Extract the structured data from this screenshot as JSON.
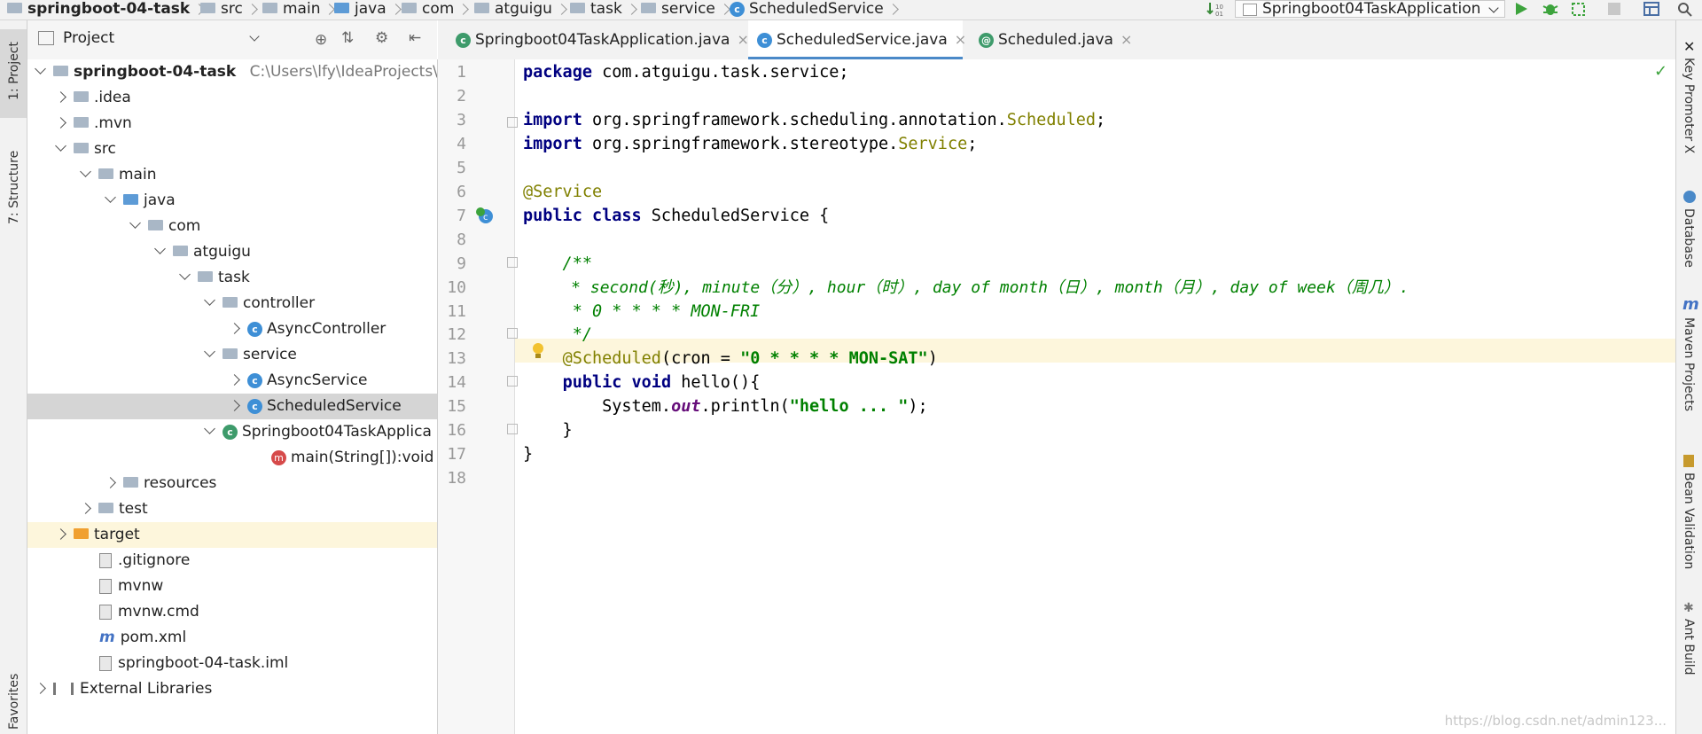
{
  "breadcrumbs": [
    "springboot-04-task",
    "src",
    "main",
    "java",
    "com",
    "atguigu",
    "task",
    "service",
    "ScheduledService"
  ],
  "run_config": "Springboot04TaskApplication",
  "left_stripe": {
    "project": "1: Project",
    "structure": "7: Structure",
    "favorites": "Favorites"
  },
  "right_stripe": {
    "key_promoter": "Key Promoter X",
    "database": "Database",
    "maven": "Maven Projects",
    "bean": "Bean Validation",
    "ant": "Ant Build"
  },
  "project_panel": {
    "title": "Project",
    "root_path": "C:\\Users\\lfy\\IdeaProjects\\sp",
    "tree": [
      {
        "label": "springboot-04-task",
        "icon": "module-folder-icon",
        "level": 0,
        "state": "open"
      },
      {
        "label": ".idea",
        "icon": "folder-icon",
        "level": 1,
        "state": "closed"
      },
      {
        "label": ".mvn",
        "icon": "folder-icon",
        "level": 1,
        "state": "closed"
      },
      {
        "label": "src",
        "icon": "folder-icon",
        "level": 1,
        "state": "open"
      },
      {
        "label": "main",
        "icon": "folder-icon",
        "level": 2,
        "state": "open"
      },
      {
        "label": "java",
        "icon": "source-folder-icon",
        "level": 3,
        "state": "open"
      },
      {
        "label": "com",
        "icon": "package-icon",
        "level": 4,
        "state": "open"
      },
      {
        "label": "atguigu",
        "icon": "package-icon",
        "level": 5,
        "state": "open"
      },
      {
        "label": "task",
        "icon": "package-icon",
        "level": 6,
        "state": "open"
      },
      {
        "label": "controller",
        "icon": "package-icon",
        "level": 7,
        "state": "open"
      },
      {
        "label": "AsyncController",
        "icon": "class-icon",
        "level": 8,
        "state": "closed"
      },
      {
        "label": "service",
        "icon": "package-icon",
        "level": 7,
        "state": "open"
      },
      {
        "label": "AsyncService",
        "icon": "class-icon",
        "level": 8,
        "state": "closed"
      },
      {
        "label": "ScheduledService",
        "icon": "class-icon",
        "level": 8,
        "state": "closed",
        "selected": true
      },
      {
        "label": "Springboot04TaskApplica",
        "icon": "spring-class-icon",
        "level": 7,
        "state": "open"
      },
      {
        "label": "main(String[]):void",
        "icon": "method-icon",
        "level": 8,
        "state": "none"
      },
      {
        "label": "resources",
        "icon": "resources-folder-icon",
        "level": 3,
        "state": "closed"
      },
      {
        "label": "test",
        "icon": "folder-icon",
        "level": 2,
        "state": "closed"
      },
      {
        "label": "target",
        "icon": "excluded-folder-icon",
        "level": 1,
        "state": "closed",
        "highlight": true
      },
      {
        "label": ".gitignore",
        "icon": "file-icon",
        "level": 1,
        "state": "none"
      },
      {
        "label": "mvnw",
        "icon": "file-icon",
        "level": 1,
        "state": "none"
      },
      {
        "label": "mvnw.cmd",
        "icon": "file-icon",
        "level": 1,
        "state": "none"
      },
      {
        "label": "pom.xml",
        "icon": "maven-icon",
        "level": 1,
        "state": "none"
      },
      {
        "label": "springboot-04-task.iml",
        "icon": "file-icon",
        "level": 1,
        "state": "none"
      },
      {
        "label": "External Libraries",
        "icon": "libraries-icon",
        "level": 0,
        "state": "closed"
      }
    ]
  },
  "tabs": [
    {
      "label": "Springboot04TaskApplication.java",
      "close": "×"
    },
    {
      "label": "ScheduledService.java",
      "close": "×",
      "active": true
    },
    {
      "label": "Scheduled.java",
      "close": "×"
    }
  ],
  "editor": {
    "lines": [
      "1",
      "2",
      "3",
      "4",
      "5",
      "6",
      "7",
      "8",
      "9",
      "10",
      "11",
      "12",
      "13",
      "14",
      "15",
      "16",
      "17",
      "18"
    ],
    "code": {
      "l1": {
        "kw": "package",
        "rest": " com.atguigu.task.service;"
      },
      "l3": {
        "kw": "import",
        "rest": " org.springframework.scheduling.annotation.",
        "ann": "Scheduled",
        "end": ";"
      },
      "l4": {
        "kw": "import",
        "rest": " org.springframework.stereotype.",
        "ann": "Service",
        "end": ";"
      },
      "l6": {
        "ann": "@Service"
      },
      "l7": {
        "kw": "public class",
        "rest": " ScheduledService {"
      },
      "l9": {
        "cmt": "    /**"
      },
      "l10": {
        "cmt": "     * second(秒), minute（分）, hour（时）, day of month（日）, month（月）, day of week（周几）."
      },
      "l11": {
        "cmt": "     * 0 * * * * MON-FRI"
      },
      "l12": {
        "cmt": "     */"
      },
      "l13": {
        "indent": "    ",
        "ann": "@Scheduled",
        "rest": "(cron = ",
        "str": "\"0 * * * * MON-SAT\"",
        "end": ")"
      },
      "l14": {
        "indent": "    ",
        "kw": "public void",
        "rest": " hello(){"
      },
      "l15": {
        "pre": "        System.",
        "it": "out",
        "rest": ".println(",
        "str": "\"hello ... \"",
        "end": ");"
      },
      "l16": {
        "rest": "    }"
      },
      "l17": {
        "rest": "}"
      }
    }
  },
  "watermark": "https://blog.csdn.net/admin123..."
}
